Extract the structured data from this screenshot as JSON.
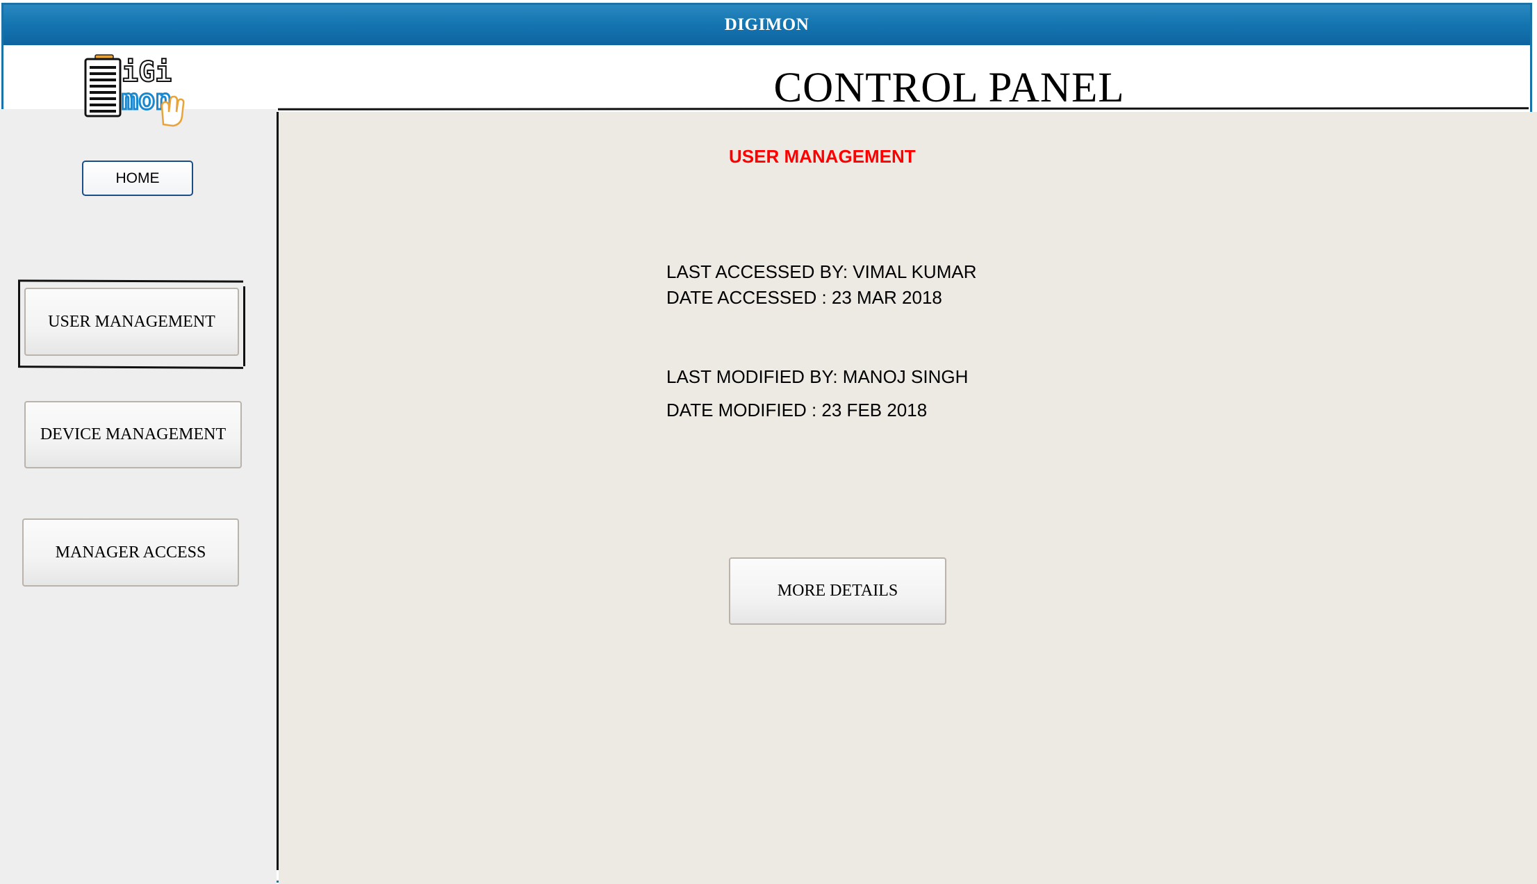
{
  "window": {
    "title": "DIGIMON"
  },
  "logo": {
    "text_top": "iGi",
    "text_bottom": "mon",
    "accent": "#1a88cf",
    "hand_color": "#e8a33a"
  },
  "header": {
    "title": "CONTROL PANEL"
  },
  "sidebar": {
    "home_label": "HOME",
    "items": [
      {
        "label": "USER MANAGEMENT",
        "selected": true
      },
      {
        "label": "DEVICE MANAGEMENT",
        "selected": false
      },
      {
        "label": "MANAGER ACCESS",
        "selected": false
      }
    ]
  },
  "main": {
    "section_title": "USER MANAGEMENT",
    "last_accessed": "LAST ACCESSED BY: VIMAL KUMAR",
    "date_accessed": "DATE ACCESSED : 23 MAR 2018",
    "last_modified": "LAST MODIFIED BY: MANOJ SINGH",
    "date_modified": "DATE MODIFIED : 23 FEB 2018",
    "more_details_label": "MORE DETAILS"
  },
  "colors": {
    "titlebar": "#1576b1",
    "sidebar_bg": "#eeeeef",
    "main_bg": "#ede9e3",
    "section_title": "#ff0000"
  }
}
